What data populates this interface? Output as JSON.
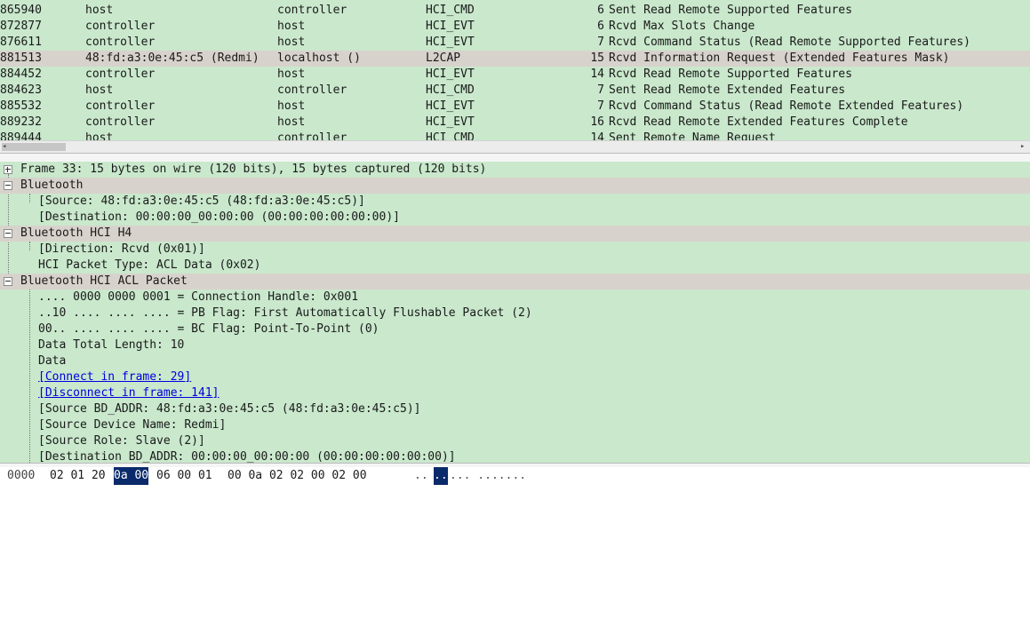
{
  "packet_list": {
    "rows": [
      {
        "no": "865940",
        "src": "host",
        "dst": "controller",
        "proto": "HCI_CMD",
        "len": "6",
        "info": "Sent Read Remote Supported Features",
        "selected": false
      },
      {
        "no": "872877",
        "src": "controller",
        "dst": "host",
        "proto": "HCI_EVT",
        "len": "6",
        "info": "Rcvd Max Slots Change",
        "selected": false
      },
      {
        "no": "876611",
        "src": "controller",
        "dst": "host",
        "proto": "HCI_EVT",
        "len": "7",
        "info": "Rcvd Command Status (Read Remote Supported Features)",
        "selected": false
      },
      {
        "no": "881513",
        "src": "48:fd:a3:0e:45:c5 (Redmi)",
        "dst": "localhost ()",
        "proto": "L2CAP",
        "len": "15",
        "info": "Rcvd Information Request (Extended Features Mask)",
        "selected": true
      },
      {
        "no": "884452",
        "src": "controller",
        "dst": "host",
        "proto": "HCI_EVT",
        "len": "14",
        "info": "Rcvd Read Remote Supported Features",
        "selected": false
      },
      {
        "no": "884623",
        "src": "host",
        "dst": "controller",
        "proto": "HCI_CMD",
        "len": "7",
        "info": "Sent Read Remote Extended Features",
        "selected": false
      },
      {
        "no": "885532",
        "src": "controller",
        "dst": "host",
        "proto": "HCI_EVT",
        "len": "7",
        "info": "Rcvd Command Status (Read Remote Extended Features)",
        "selected": false
      },
      {
        "no": "889232",
        "src": "controller",
        "dst": "host",
        "proto": "HCI_EVT",
        "len": "16",
        "info": "Rcvd Read Remote Extended Features Complete",
        "selected": false
      },
      {
        "no": "889444",
        "src": "host",
        "dst": "controller",
        "proto": "HCI_CMD",
        "len": "14",
        "info": "Sent Remote Name Request",
        "selected": false
      }
    ]
  },
  "detail": {
    "frame": "Frame 33: 15 bytes on wire (120 bits), 15 bytes captured (120 bits)",
    "bluetooth": "Bluetooth",
    "bt_source": "[Source: 48:fd:a3:0e:45:c5 (48:fd:a3:0e:45:c5)]",
    "bt_destination": "[Destination: 00:00:00_00:00:00 (00:00:00:00:00:00)]",
    "h4": "Bluetooth HCI H4",
    "h4_direction": "[Direction: Rcvd (0x01)]",
    "h4_type": "HCI Packet Type: ACL Data (0x02)",
    "acl": "Bluetooth HCI ACL Packet",
    "acl_handle": ".... 0000 0000 0001 = Connection Handle: 0x001",
    "acl_pb": "..10 .... .... .... = PB Flag: First Automatically Flushable Packet (2)",
    "acl_bc": "00.. .... .... .... = BC Flag: Point-To-Point (0)",
    "acl_len": "Data Total Length: 10",
    "acl_data": "Data",
    "acl_connect": "[Connect in frame: 29]",
    "acl_disconnect": "[Disconnect in frame: 141]",
    "acl_src_bdaddr": "[Source BD_ADDR: 48:fd:a3:0e:45:c5 (48:fd:a3:0e:45:c5)]",
    "acl_src_name": "[Source Device Name: Redmi]",
    "acl_src_role": "[Source Role: Slave (2)]",
    "acl_dst_bdaddr": "[Destination BD_ADDR: 00:00:00_00:00:00 (00:00:00:00:00:00)]"
  },
  "bytes": {
    "offset": "0000",
    "hex_a": "02 01 20",
    "hex_hl": "0a 00",
    "hex_b": "06 00 01",
    "hex_c": "00 0a 02 02 00 02 00",
    "ascii_a": "..",
    "ascii_hl": "..",
    "ascii_b": "... .......",
    "highlight_color": "#0a2a6b"
  },
  "colors": {
    "pane_bg": "#c9e8cc",
    "selected_row": "#d8d2cc",
    "link": "#0000dd"
  }
}
